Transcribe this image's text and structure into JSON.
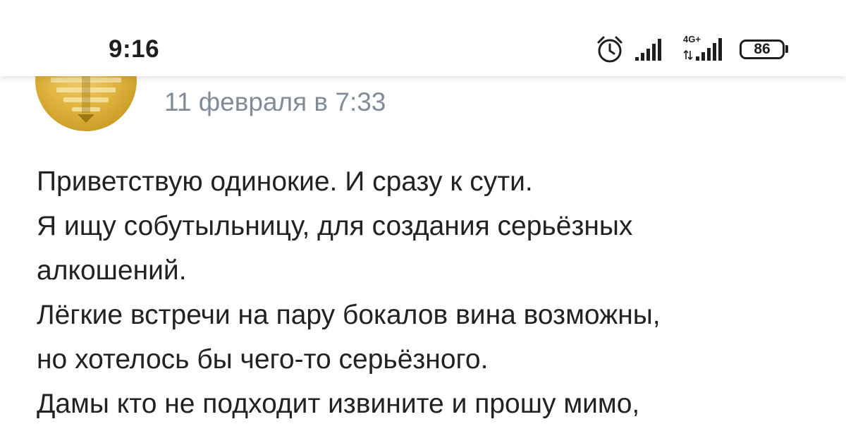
{
  "status_bar": {
    "time": "9:16",
    "battery": "86",
    "network_label": "4G+",
    "icons": [
      "alarm-icon",
      "signal-icon",
      "signal-4g-icon",
      "battery-icon"
    ]
  },
  "post": {
    "date": "11 февраля в 7:33",
    "lines": [
      "Приветствую одинокие. И сразу к сути.",
      "Я ищу собутыльницу, для создания серьёзных",
      "алкошений.",
      "Лёгкие встречи на пару бокалов вина возможны,",
      "но хотелось бы чего-то серьёзного.",
      "Дамы кто не подходит извините и прошу мимо,"
    ]
  },
  "colors": {
    "date": "#818c99",
    "text": "#222222",
    "avatar": "#d9ac35"
  }
}
